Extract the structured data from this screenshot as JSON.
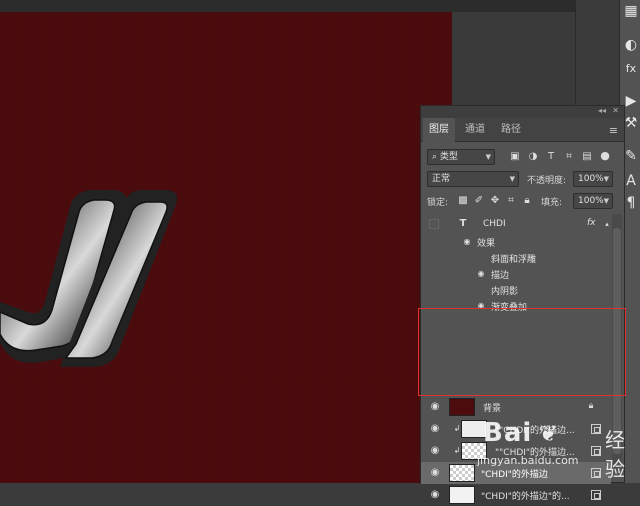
{
  "panel": {
    "tabs": [
      {
        "label": "图层",
        "active": true
      },
      {
        "label": "通道",
        "active": false
      },
      {
        "label": "路径",
        "active": false
      }
    ],
    "filter": {
      "label": "类型"
    },
    "blend_mode": "正常",
    "opacity_label": "不透明度:",
    "opacity_value": "100%",
    "lock_label": "锁定:",
    "fill_label": "填充:",
    "fill_value": "100%"
  },
  "layers": [
    {
      "type": "text",
      "name": "CHDI",
      "fx": "fx"
    },
    {
      "type": "effects_header",
      "name": "效果"
    },
    {
      "type": "effect",
      "name": "斜面和浮雕"
    },
    {
      "type": "effect",
      "name": "描边"
    },
    {
      "type": "effect",
      "name": "内阴影"
    },
    {
      "type": "effect",
      "name": "渐变叠加"
    },
    {
      "type": "smart",
      "name": "\"\"CHDI\"的外描边...",
      "clipped": true,
      "thumb": "text"
    },
    {
      "type": "smart",
      "name": "\"\"CHDI\"的外描边...",
      "clipped": true,
      "thumb": "checker"
    },
    {
      "type": "smart",
      "name": "\"CHDI\"的外描边",
      "selected": true,
      "thumb": "outline"
    },
    {
      "type": "smart",
      "name": "\"CHDI\"的外描边\"的...",
      "thumb": "dark"
    },
    {
      "type": "background",
      "name": "背景",
      "locked": true
    }
  ],
  "watermark": {
    "brand": "Bai",
    "brand2": "经验",
    "url": "jingyan.baidu.com"
  },
  "colors": {
    "canvas": "#4c0c0e",
    "highlight_box": "#e03030",
    "panel_bg": "#535353"
  }
}
